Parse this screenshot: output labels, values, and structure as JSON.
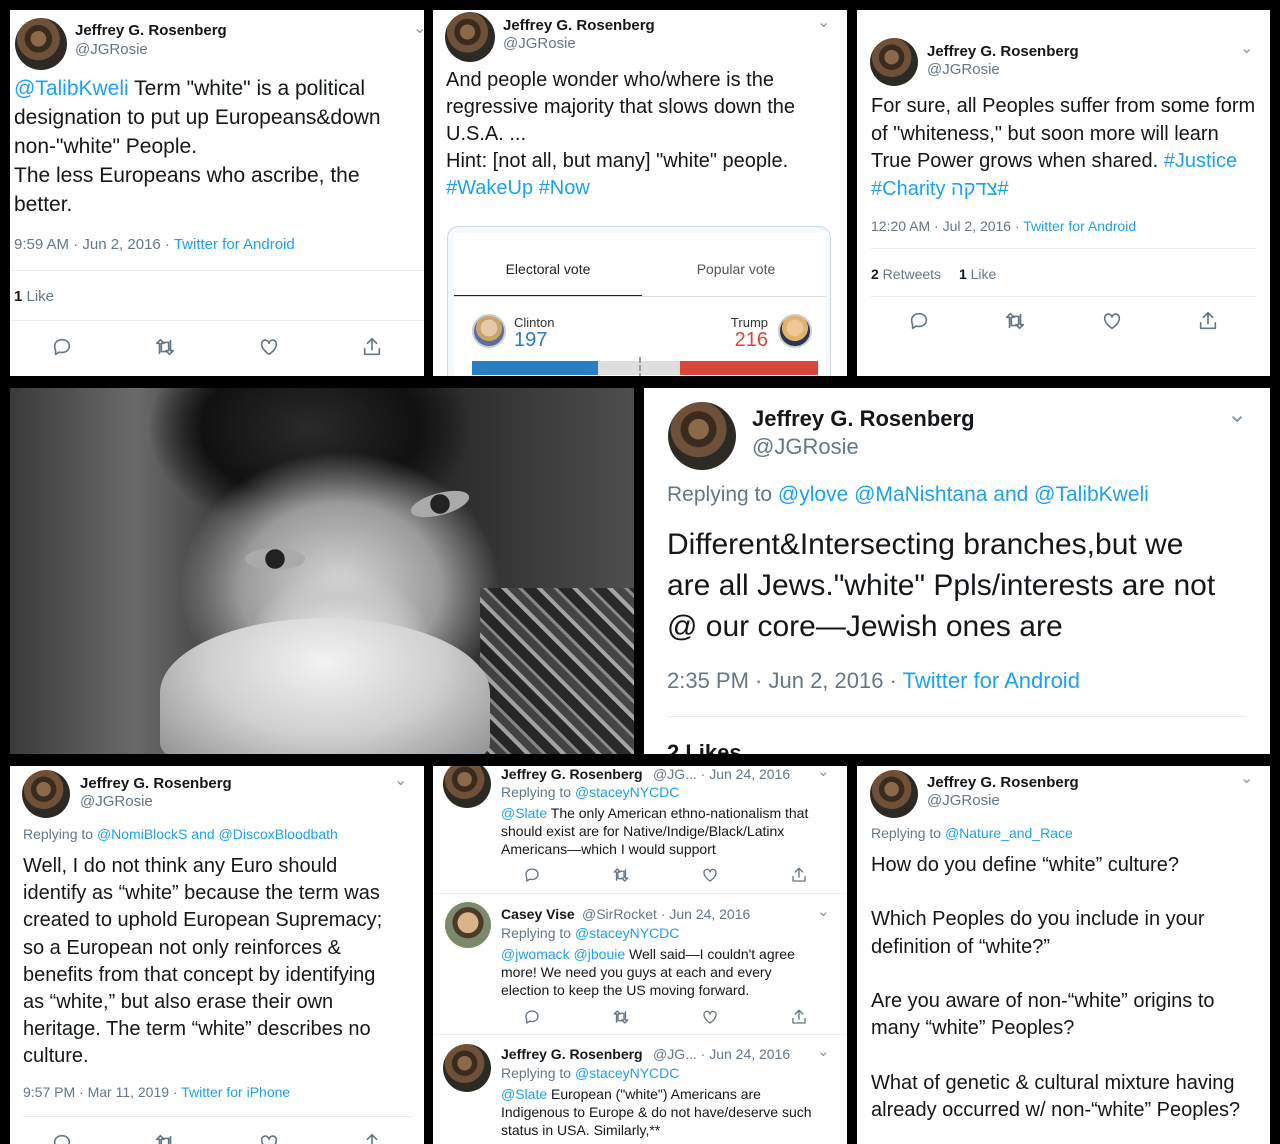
{
  "tweet1": {
    "name": "Jeffrey G. Rosenberg",
    "handle": "@JGRosie",
    "mention": "@TalibKweli",
    "text_lines": [
      "Term \"white\" is a political",
      "designation to put up Europeans&down",
      "non-\"white\" People.",
      "The less Europeans who ascribe, the",
      "better."
    ],
    "time": "9:59 AM · Jun 2, 2016 · ",
    "source": "Twitter for Android",
    "likes_count": "1",
    "likes_label": " Like"
  },
  "tweet2": {
    "name": "Jeffrey G. Rosenberg",
    "handle": "@JGRosie",
    "text_lines": [
      "And people wonder who/where is the",
      "regressive majority that slows down the",
      "U.S.A. ...",
      "Hint: [not all, but many] \"white\" people."
    ],
    "hashtags": "#WakeUp #Now",
    "card": {
      "tab_active": "Electoral vote",
      "tab_inactive": "Popular vote",
      "left_name": "Clinton",
      "left_value": "197",
      "right_name": "Trump",
      "right_value": "216",
      "left_color": "#2a7ec4",
      "right_color": "#d9463a"
    }
  },
  "tweet3": {
    "name": "Jeffrey G. Rosenberg",
    "handle": "@JGRosie",
    "text_lines": [
      "For sure, all Peoples suffer from some form",
      "of \"whiteness,\" but soon more will learn",
      "True Power grows when shared. "
    ],
    "hashtag1": "#Justice",
    "hashtag2": "#Charity צדקה#",
    "time": "12:20 AM · Jul 2, 2016 · ",
    "source": "Twitter for Android",
    "retweets_count": "2",
    "retweets_label": " Retweets",
    "likes_count": "1",
    "likes_label": " Like"
  },
  "tweet4": {
    "name": "Jeffrey G. Rosenberg",
    "handle": "@JGRosie",
    "replying_prefix": "Replying to ",
    "replying_to": "@ylove @MaNishtana and @TalibKweli",
    "text_lines": [
      "Different&Intersecting branches,but we",
      "are all Jews.\"white\" Ppls/interests are not",
      "@ our core—Jewish ones are"
    ],
    "time": "2:35 PM · Jun 2, 2016 · ",
    "source": "Twitter for Android",
    "likes_partial": "2 Likes"
  },
  "tweet5": {
    "name": "Jeffrey G. Rosenberg",
    "handle": "@JGRosie",
    "replying_prefix": "Replying to ",
    "replying_to": "@NomiBlockS and @DiscoxBloodbath",
    "text_lines": [
      "Well, I do not think any Euro should",
      "identify as “white” because the term was",
      "created to uphold European Supremacy;",
      "so a European not only reinforces &",
      "benefits from that concept by identifying",
      "as “white,” but also erase their own",
      "heritage. The term “white” describes no",
      "culture."
    ],
    "time": "9:57 PM · Mar 11, 2019 · ",
    "source": "Twitter for iPhone"
  },
  "thread": {
    "items": [
      {
        "name": "Jeffrey G. Rosenberg",
        "handle_date": "@JG...  · Jun 24, 2016",
        "replying_prefix": "Replying to ",
        "replying_to": "@staceyNYCDC",
        "mention": "@Slate",
        "text_lines": [
          " The only American ethno-nationalism that",
          "should exist are for Native/Indige/Black/Latinx",
          "Americans—which I would support"
        ]
      },
      {
        "name": "Casey Vise",
        "handle_date": "@SirRocket · Jun 24, 2016",
        "replying_prefix": "Replying to ",
        "replying_to": "@staceyNYCDC",
        "mention": "@jwomack @jbouie",
        "text_lines": [
          " Well said—I couldn't agree",
          "more! We need you guys at each and every",
          "election to keep the US moving forward."
        ]
      },
      {
        "name": "Jeffrey G. Rosenberg",
        "handle_date": "@JG...  · Jun 24, 2016",
        "replying_prefix": "Replying to ",
        "replying_to": "@staceyNYCDC",
        "mention": "@Slate",
        "text_lines": [
          " European (\"white\") Americans are",
          "Indigenous to Europe & do not have/deserve such",
          "status in USA. Similarly,**"
        ]
      }
    ]
  },
  "tweet6": {
    "name": "Jeffrey G. Rosenberg",
    "handle": "@JGRosie",
    "replying_prefix": "Replying to ",
    "replying_to": "@Nature_and_Race",
    "paragraphs": [
      [
        "How do you define “white” culture?"
      ],
      [
        "Which Peoples do you include in your",
        "definition of “white?”"
      ],
      [
        "Are you aware of non-“white” origins to",
        "many “white” Peoples?"
      ],
      [
        "What of genetic & cultural mixture having",
        "already occurred w/ non-“white” Peoples?"
      ]
    ]
  }
}
